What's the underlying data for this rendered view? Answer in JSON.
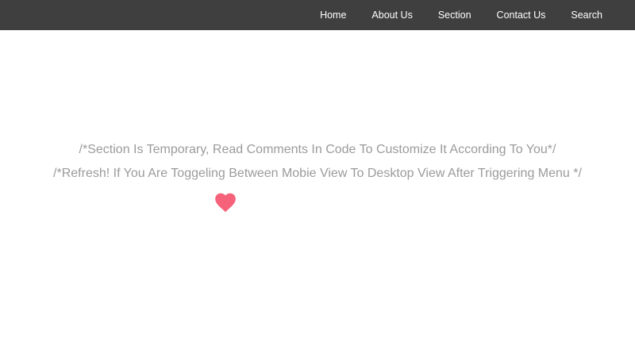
{
  "nav": {
    "items": [
      {
        "label": "Home"
      },
      {
        "label": "About Us"
      },
      {
        "label": "Section"
      },
      {
        "label": "Contact Us"
      },
      {
        "label": "Search"
      }
    ]
  },
  "main": {
    "line1": "/*Section Is Temporary, Read Comments In Code To Customize It According To You*/",
    "line2": "/*Refresh! If You Are Toggeling Between Mobie View To Desktop View After Triggering Menu */",
    "heart_icon": "heart-icon",
    "heart_color": "#f5627a"
  },
  "colors": {
    "navbar_bg": "#3f3f3f",
    "nav_text": "#ffffff",
    "body_text": "#9b9b9b"
  }
}
